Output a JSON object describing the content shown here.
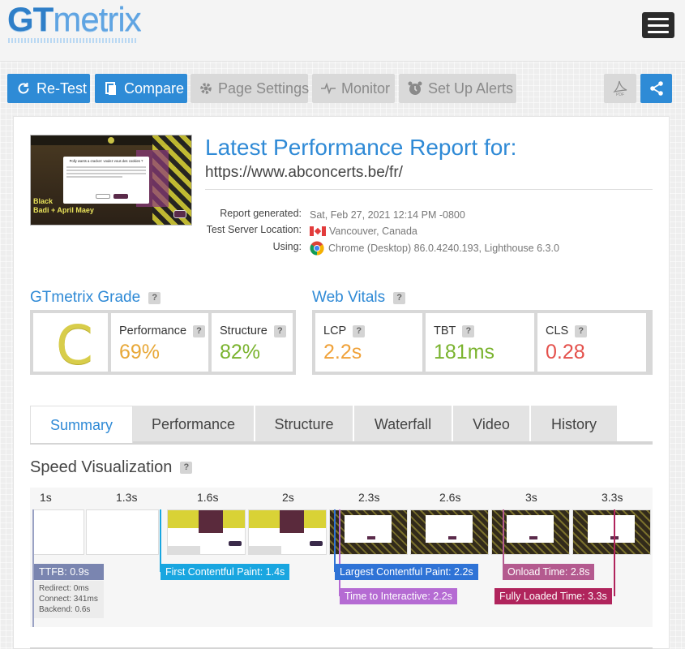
{
  "brand": {
    "logo_gt": "GT",
    "logo_metrix": "metrix"
  },
  "toolbar": {
    "retest_label": "Re-Test",
    "compare_label": "Compare",
    "page_settings_label": "Page Settings",
    "monitor_label": "Monitor",
    "alerts_label": "Set Up Alerts",
    "pdf_label": "PDF"
  },
  "report": {
    "title": "Latest Performance Report for:",
    "url": "https://www.abconcerts.be/fr/",
    "generated_label": "Report generated:",
    "generated_value": "Sat, Feb 27, 2021 12:14 PM -0800",
    "location_label": "Test Server Location:",
    "location_value": "Vancouver, Canada",
    "using_label": "Using:",
    "using_value": "Chrome (Desktop) 86.0.4240.193, Lighthouse 6.3.0"
  },
  "thumbnail": {
    "popup_title": "Polly wants a cracker: voulez vous des cookies ?",
    "headline_1": "Black",
    "headline_2": "Badi + April Maey"
  },
  "grade": {
    "title": "GTmetrix Grade",
    "letter": "C",
    "performance_label": "Performance",
    "performance_value": "69%",
    "structure_label": "Structure",
    "structure_value": "82%"
  },
  "vitals": {
    "title": "Web Vitals",
    "lcp_label": "LCP",
    "lcp_value": "2.2s",
    "tbt_label": "TBT",
    "tbt_value": "181ms",
    "cls_label": "CLS",
    "cls_value": "0.28"
  },
  "tabs": [
    "Summary",
    "Performance",
    "Structure",
    "Waterfall",
    "Video",
    "History"
  ],
  "speed": {
    "title": "Speed Visualization",
    "ticks": [
      "1s",
      "1.3s",
      "1.6s",
      "2s",
      "2.3s",
      "2.6s",
      "3s",
      "3.3s"
    ],
    "ttfb": "TTFB: 0.9s",
    "redirect": "Redirect: 0ms",
    "connect": "Connect: 341ms",
    "backend": "Backend: 0.6s",
    "fcp": "First Contentful Paint: 1.4s",
    "lcp": "Largest Contentful Paint: 2.2s",
    "tti": "Time to Interactive: 2.2s",
    "onload": "Onload Time: 2.8s",
    "fully_loaded": "Fully Loaded Time: 3.3s"
  },
  "colors": {
    "accent": "#2e8bd6",
    "perf": "#e8a838",
    "structure": "#7ab32e",
    "lcp": "#f0a23a",
    "tbt": "#7ab32e",
    "cls": "#e4504b",
    "ttfb": "#7a85b0",
    "fcp": "#19a6e0",
    "lcp_marker": "#2f73d6",
    "tti_marker": "#b56bd3",
    "onload_marker": "#b45a8f",
    "fully_marker": "#b0245c"
  }
}
